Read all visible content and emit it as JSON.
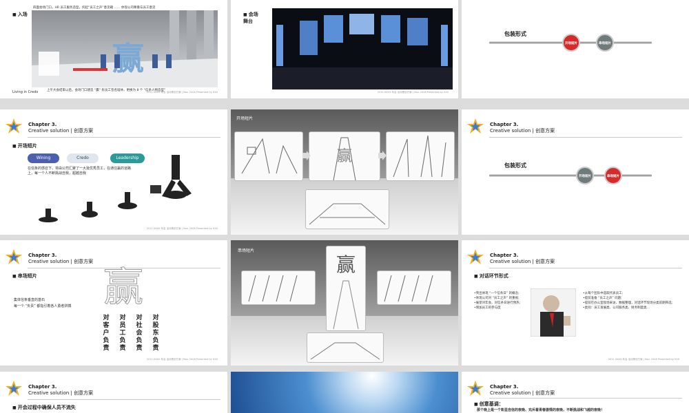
{
  "slides": {
    "s1": {
      "header": "四面会场门口，HR 员工服务造型，托起“员工之声”意见箱 …… 体现公司尊重与员工意见",
      "section": "入场",
      "caption": "上午大会结束以后，会场门口建造 “赢” 形员工签名墙体，更换为 8 个 “信条人物造型”",
      "corner": "Living in Credo",
      "char": "赢",
      "footer": "2011 XXXX 年会 活动策划方案 | Nov. 2008 Presented by XXX"
    },
    "s2": {
      "section": "会场",
      "subsection": "舞台",
      "footer": "2011 XXXX 年会 活动策划方案 | Nov. 2008 Presented by XXX"
    },
    "s3": {
      "title": "包装形式",
      "btn_left": "开场短片",
      "btn_right": "串场短片"
    },
    "s4": {
      "chapter": "Chapter 3.",
      "subtitle": "Creative solution | 创意方案",
      "section": "开场短片",
      "pills": [
        "Wining",
        "Credo",
        "Leadership"
      ],
      "desc": "在信条的感召下，将由公司汇聚了一大批优秀员工，在通往赢的道路上，每一个人不断挑战自我，超越自我",
      "footer": "2011 XXXX 年会 活动策划方案 | Nov. 2008 Presented by XXX"
    },
    "s5": {
      "label": "开场短片",
      "char": "赢"
    },
    "s6": {
      "chapter": "Chapter 3.",
      "subtitle": "Creative solution | 创意方案",
      "title": "包装形式",
      "btn_left": "开场短片",
      "btn_right": "串场短片"
    },
    "s7": {
      "chapter": "Chapter 3.",
      "subtitle": "Creative solution | 创意方案",
      "section": "串场短片",
      "desc1": "集体信条垂直的基石",
      "desc2": "每一个 “负责” 都指引着各人勇者拼搏",
      "char": "赢",
      "columns": [
        "对客户负责",
        "对员工负责",
        "对社会负责",
        "对股东负责"
      ],
      "footer": "2011 XXXX 年会 活动策划方案 | Nov. 2008 Presented by XXX"
    },
    "s8": {
      "label": "串场短片",
      "char": "赢"
    },
    "s9": {
      "chapter": "Chapter 3.",
      "subtitle": "Creative solution | 创意方案",
      "section": "对话环节形式",
      "left_list": [
        "•突出体现 “一个信条日” 的概念;",
        "•体现公司对 “员工之声” 的重视;",
        "•展望对年会、对信条日进行预热;",
        "•增加员工的参与度"
      ],
      "right_list": [
        "•从每个团队中选取代表员工;",
        "•提前准备 “员工之声” 问题;",
        "•提前在办公室现场采访，数据整理，对话环节现场分类前期筛选;",
        "•类别：员工发展类、公司服务类、财务制度类…"
      ],
      "footer": "2011 XXXX 年会 活动策划方案 | Nov. 2008 Presented by XXX"
    },
    "s10": {
      "chapter": "Chapter 3.",
      "subtitle": "Creative solution | 创意方案",
      "section": "开会过程中确保人员不流失"
    },
    "s12": {
      "chapter": "Chapter 3.",
      "subtitle": "Creative solution | 创意方案",
      "section": "创意基调：",
      "desc": "那个晚上是一个彰显自信的夜晚、充斥着青春激情的夜晚，不断挑战和飞越的夜晚！"
    }
  },
  "colors": {
    "red_bubble": "#d42b2b",
    "grey_bubble": "#6f7a7a",
    "pill_blue": "#4b5fb0",
    "pill_teal": "#2d9a9a"
  }
}
